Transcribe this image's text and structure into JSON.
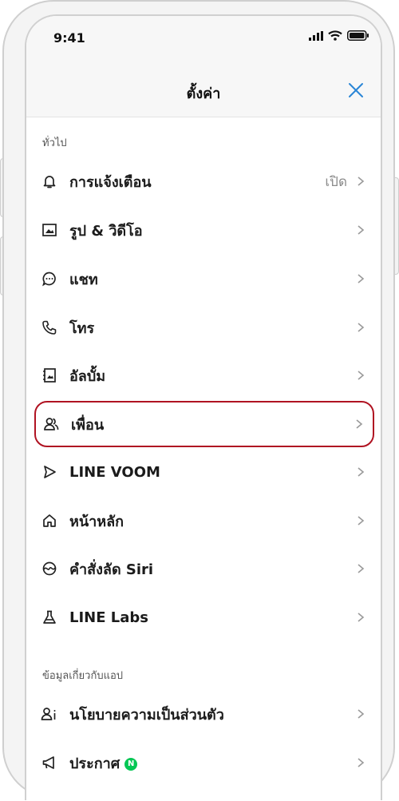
{
  "status": {
    "time": "9:41"
  },
  "header": {
    "title": "ตั้งค่า"
  },
  "sections": [
    {
      "title": "ทั่วไป"
    },
    {
      "title": "ข้อมูลเกี่ยวกับแอป"
    }
  ],
  "items": [
    {
      "label": "การแจ้งเตือน",
      "value": "เปิด",
      "icon": "bell-icon"
    },
    {
      "label": "รูป & วิดีโอ",
      "icon": "image-icon"
    },
    {
      "label": "แชท",
      "icon": "chat-icon"
    },
    {
      "label": "โทร",
      "icon": "phone-icon"
    },
    {
      "label": "อัลบั้ม",
      "icon": "album-icon"
    },
    {
      "label": "เพื่อน",
      "icon": "friends-icon",
      "highlighted": true
    },
    {
      "label": "LINE VOOM",
      "icon": "voom-icon"
    },
    {
      "label": "หน้าหลัก",
      "icon": "home-icon"
    },
    {
      "label": "คำสั่งลัด Siri",
      "icon": "siri-icon"
    },
    {
      "label": "LINE Labs",
      "icon": "flask-icon"
    },
    {
      "label": "นโยบายความเป็นส่วนตัว",
      "icon": "privacy-icon"
    },
    {
      "label": "ประกาศ",
      "icon": "megaphone-icon",
      "badge": "N"
    }
  ],
  "colors": {
    "accent": "#2a86d6",
    "highlight_border": "#b01322",
    "badge": "#06c755"
  }
}
